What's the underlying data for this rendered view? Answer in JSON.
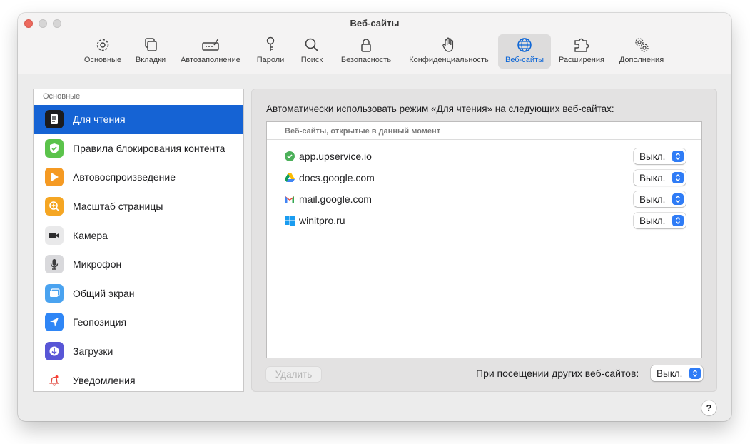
{
  "window": {
    "title": "Веб-сайты"
  },
  "toolbar": {
    "tabs": [
      {
        "label": "Основные",
        "icon": "gear-icon"
      },
      {
        "label": "Вкладки",
        "icon": "tabs-icon"
      },
      {
        "label": "Автозаполнение",
        "icon": "autofill-icon"
      },
      {
        "label": "Пароли",
        "icon": "key-icon"
      },
      {
        "label": "Поиск",
        "icon": "search-icon"
      },
      {
        "label": "Безопасность",
        "icon": "lock-icon"
      },
      {
        "label": "Конфиденциальность",
        "icon": "hand-icon"
      },
      {
        "label": "Веб-сайты",
        "icon": "globe-icon",
        "active": true
      },
      {
        "label": "Расширения",
        "icon": "puzzle-icon"
      },
      {
        "label": "Дополнения",
        "icon": "gears-icon"
      }
    ]
  },
  "sidebar": {
    "heading": "Основные",
    "items": [
      {
        "label": "Для чтения",
        "icon": "reader-icon",
        "color": "#1c1c1e",
        "selected": true
      },
      {
        "label": "Правила блокирования контента",
        "icon": "content-blocker-icon",
        "color": "#5bc34b"
      },
      {
        "label": "Автовоспроизведение",
        "icon": "play-icon",
        "color": "#f59a23"
      },
      {
        "label": "Масштаб страницы",
        "icon": "zoom-icon",
        "color": "#f5a623"
      },
      {
        "label": "Камера",
        "icon": "camera-icon",
        "color": "#3a3a3c"
      },
      {
        "label": "Микрофон",
        "icon": "microphone-icon",
        "color": "#8e8e93"
      },
      {
        "label": "Общий экран",
        "icon": "screen-sharing-icon",
        "color": "#4aa3f0"
      },
      {
        "label": "Геопозиция",
        "icon": "location-icon",
        "color": "#2f86f6"
      },
      {
        "label": "Загрузки",
        "icon": "downloads-icon",
        "color": "#5856d6"
      },
      {
        "label": "Уведомления",
        "icon": "notifications-icon",
        "color": "#ff3b30"
      }
    ]
  },
  "main": {
    "description": "Автоматически использовать режим «Для чтения» на следующих веб-сайтах:",
    "list_heading": "Веб-сайты, открытые в данный момент",
    "sites": [
      {
        "domain": "app.upservice.io",
        "icon": "upservice-icon",
        "value": "Выкл."
      },
      {
        "domain": "docs.google.com",
        "icon": "google-drive-icon",
        "value": "Выкл."
      },
      {
        "domain": "mail.google.com",
        "icon": "gmail-icon",
        "value": "Выкл."
      },
      {
        "domain": "winitpro.ru",
        "icon": "windows-icon",
        "value": "Выкл."
      }
    ],
    "delete_label": "Удалить",
    "other_sites_label": "При посещении других веб-сайтов:",
    "other_sites_value": "Выкл."
  },
  "help": {
    "label": "?"
  },
  "colors": {
    "accent": "#1563d4",
    "popup_chevron": "#2f7cf6",
    "close_button": "#ed6a5e"
  }
}
